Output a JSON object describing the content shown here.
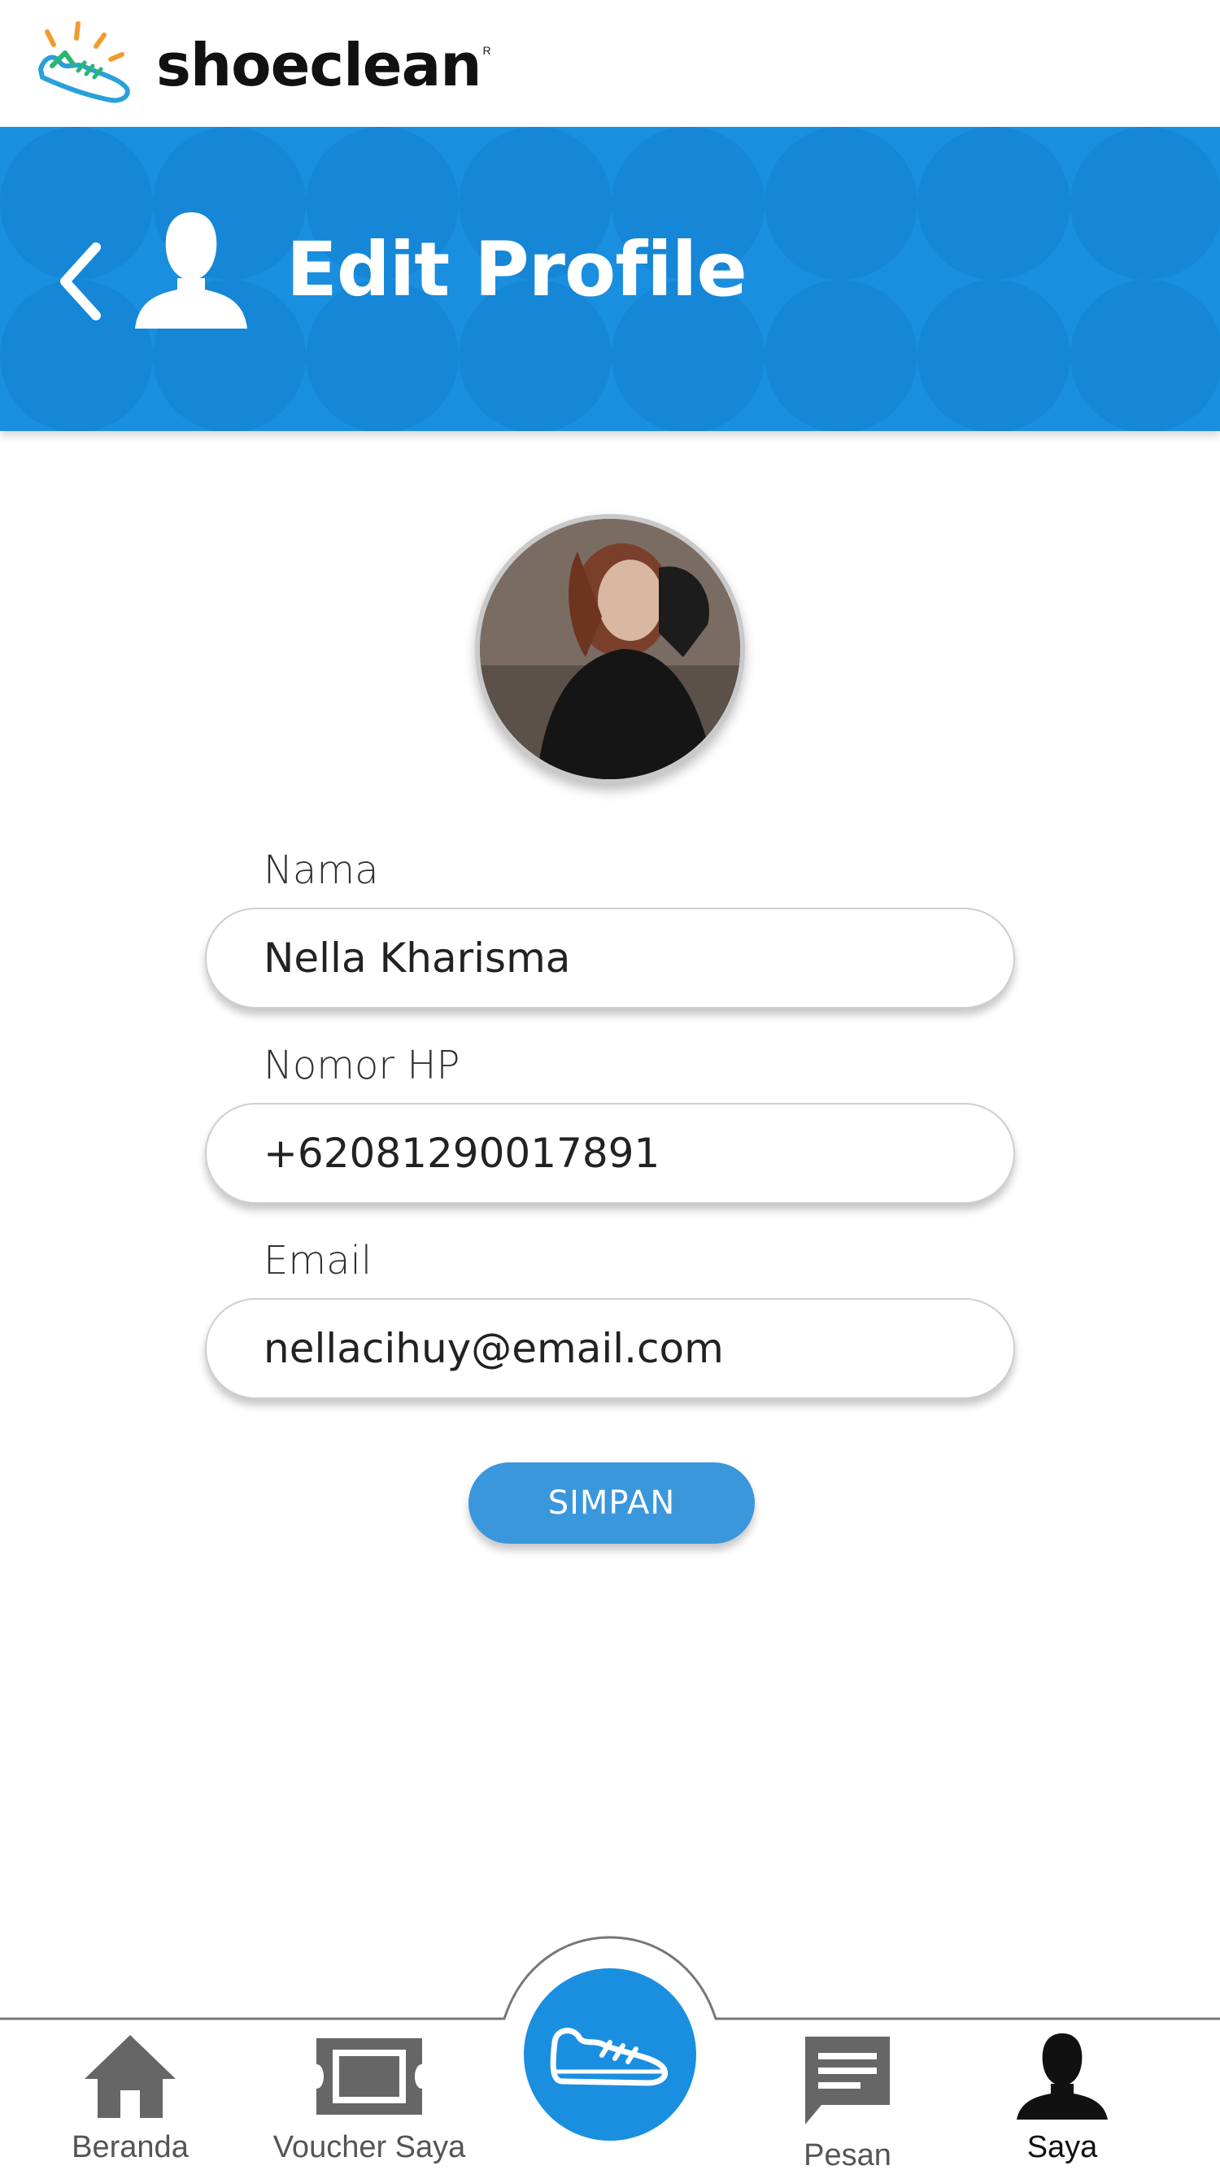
{
  "app": {
    "brand_name": "shoeclean",
    "brand_mark": "R"
  },
  "header": {
    "title": "Edit Profile",
    "back_icon": "chevron-left-icon",
    "user_icon": "person-icon",
    "color": "#1a8fe0"
  },
  "form": {
    "name": {
      "label": "Nama",
      "value": "Nella Kharisma"
    },
    "phone": {
      "label": "Nomor HP",
      "value": "+62081290017891"
    },
    "email": {
      "label": "Email",
      "value": "nellacihuy@email.com"
    },
    "save_label": "SIMPAN"
  },
  "bottom_nav": {
    "items": [
      {
        "label": "Beranda",
        "icon": "home-icon"
      },
      {
        "label": "Voucher Saya",
        "icon": "ticket-icon"
      },
      {
        "label": "",
        "icon": "shoe-icon"
      },
      {
        "label": "Pesan",
        "icon": "message-icon"
      },
      {
        "label": "Saya",
        "icon": "person-icon",
        "active": true
      }
    ]
  },
  "colors": {
    "accent": "#1a8fe0",
    "button": "#3b97dc",
    "nav_icon": "#666666",
    "nav_active": "#111111"
  }
}
